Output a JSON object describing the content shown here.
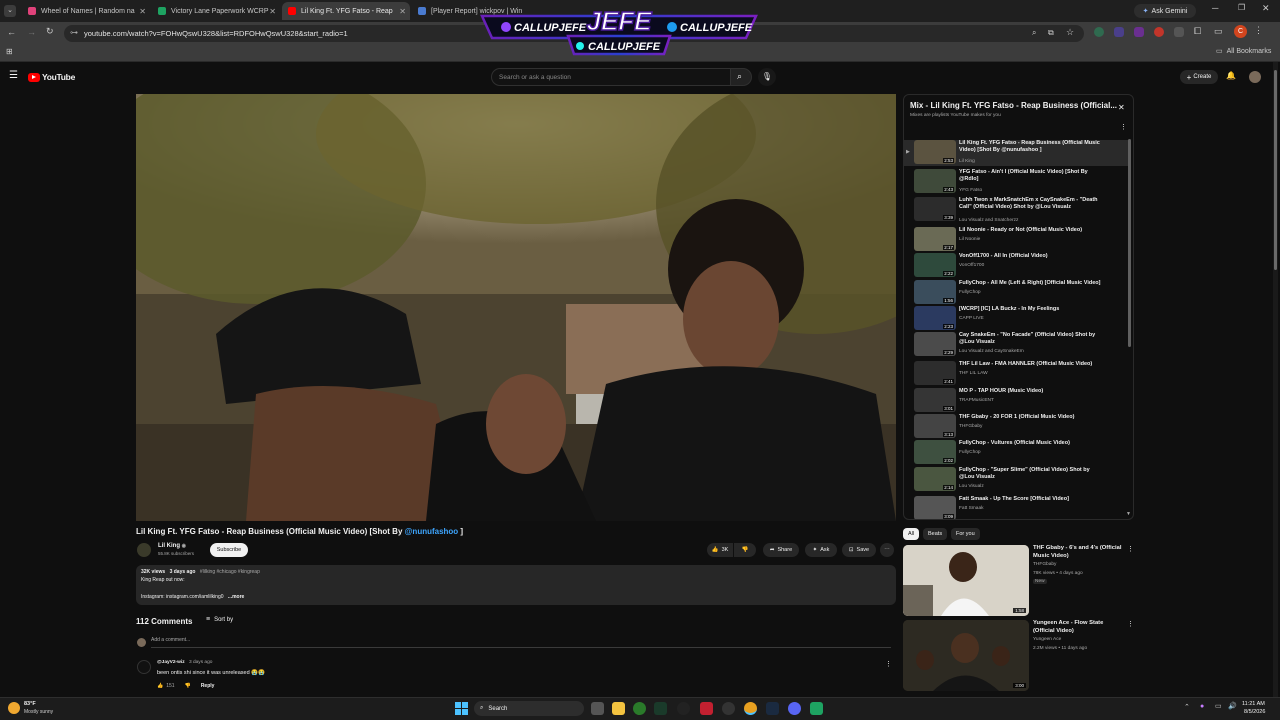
{
  "tabs": [
    {
      "title": "Wheel of Names | Random na",
      "color": "#e0427a"
    },
    {
      "title": "Victory Lane Paperwork WCRP",
      "color": "#1ea362"
    },
    {
      "title": "Lil King Ft. YFG Fatso - Reap",
      "color": "#ff0000"
    },
    {
      "title": "[Player Report] wickpov | Win",
      "color": "#4a7bd0"
    }
  ],
  "address": "youtube.com/watch?v=FOHwQswU328&list=RDFOHwQswU328&start_radio=1",
  "ask_gemini": "Ask Gemini",
  "all_bookmarks": "All Bookmarks",
  "overlay": {
    "brand": "JEFE",
    "handle_left": "CALLUPJEFE",
    "handle_right": "CALLUPJEFE",
    "handle_bottom": "CALLUPJEFE"
  },
  "yt": {
    "logo": "YouTube",
    "search_placeholder": "Search or ask a question",
    "create": "Create"
  },
  "video": {
    "title_prefix": "Lil King Ft. YFG Fatso - Reap Business (Official Music Video) [Shot By ",
    "title_link": "@nunufashoo",
    "title_suffix": " ]",
    "channel": "Lil King",
    "subscribers": "55.8K subscribers",
    "subscribe": "Subscribe",
    "likes": "3K",
    "share": "Share",
    "ask": "Ask",
    "save": "Save",
    "views": "32K views",
    "age": "3 days ago",
    "tags": "#lilking #chicago #kingreap",
    "desc_line1": "King Reap out now:",
    "desc_line2": "Instagram: instagram.com/iamlilking0",
    "more": "...more"
  },
  "comments": {
    "count": "112 Comments",
    "sort": "Sort by",
    "add": "Add a comment...",
    "first_user": "@JayV2-wiz",
    "first_age": "3 days ago",
    "first_text": "been ontis shi since it was unreleased 😭😭",
    "first_likes": "151",
    "reply": "Reply"
  },
  "playlist": {
    "title": "Mix - Lil King Ft. YFG Fatso - Reap Business (Official...",
    "subtitle": "Mixes are playlists YouTube makes for you",
    "items": [
      {
        "title": "Lil King Ft. YFG Fatso - Reap Business (Official Music Video) [Shot By @nunufashoo ]",
        "channel": "Lil King",
        "duration": "2:53",
        "color": "#5b5340"
      },
      {
        "title": "YFG Fatso - Ain't I (Official Music Video) [Shot By @Rdlo]",
        "channel": "YFG Fatso",
        "duration": "2:43",
        "color": "#3f4a3a"
      },
      {
        "title": "Luhh Twon x MarkSnatchEm x CaySnakeEm - \"Death Call\" (Official Video) Shot by @Lou Visualz",
        "channel": "Lou Visualz and Snatcherzz",
        "duration": "3:39",
        "color": "#2c2c2c"
      },
      {
        "title": "Lil Noonie - Ready or Not (Official Music Video)",
        "channel": "Lil Noonie",
        "duration": "2:17",
        "color": "#6a6a55"
      },
      {
        "title": "VonOff1700 - All In (Official Video)",
        "channel": "VonOff1700",
        "duration": "2:22",
        "color": "#2e4a3c"
      },
      {
        "title": "FullyChop - All Me (Left & Right) [Official Music Video]",
        "channel": "FullyChop",
        "duration": "1:56",
        "color": "#3a4d5c"
      },
      {
        "title": "[WCRP] [IC] LA Buckz - In My Feelings",
        "channel": "CAPP LIVE",
        "duration": "2:23",
        "color": "#2b3a60"
      },
      {
        "title": "Cay SnakeEm - \"No Facade\" (Official Video) Shot by @Lou Visualz",
        "channel": "Lou Visualz and CaySnakeEm",
        "duration": "2:29",
        "color": "#4b4b4b"
      },
      {
        "title": "THF Lil Law - FMA HANNLER (Official Music Video)",
        "channel": "THF LIL LAW",
        "duration": "2:41",
        "color": "#2d2d2d"
      },
      {
        "title": "MO P - TAP HOUR (Music Video)",
        "channel": "TRAPMusicENT",
        "duration": "3:01",
        "color": "#353535"
      },
      {
        "title": "THF Gbaby - 20 FOR 1 (Official Music Video)",
        "channel": "THFGbaby",
        "duration": "3:13",
        "color": "#444"
      },
      {
        "title": "FullyChop - Vultures (Official Music Video)",
        "channel": "FullyChop",
        "duration": "2:02",
        "color": "#3e5040"
      },
      {
        "title": "FullyChop - \"Super Slime\" (Official Video) Shot by @Lou Visualz",
        "channel": "Lou Visualz",
        "duration": "2:14",
        "color": "#4a5640"
      },
      {
        "title": "Fatt Smaak - Up The Score [Official Video]",
        "channel": "Fatt Smaak",
        "duration": "3:09",
        "color": "#555"
      }
    ]
  },
  "chips": [
    "All",
    "Beats",
    "For you"
  ],
  "recommendations": [
    {
      "title": "THF Gbaby - 6's and 4's (Official Music Video)",
      "channel": "THFGbaby",
      "meta": "78K views • 4 days ago",
      "badge": "New",
      "duration": "1:58",
      "color": "#c9c2b5"
    },
    {
      "title": "Yungeen Ace - Flow State (Official Video)",
      "channel": "Yungeen Ace",
      "meta": "2.2M views • 11 days ago",
      "badge": "",
      "duration": "3:00",
      "color": "#3b3527"
    }
  ],
  "taskbar": {
    "temp": "83°F",
    "weather": "Mostly sunny",
    "search": "Search",
    "time": "11:21 AM",
    "date": "8/5/2026"
  }
}
